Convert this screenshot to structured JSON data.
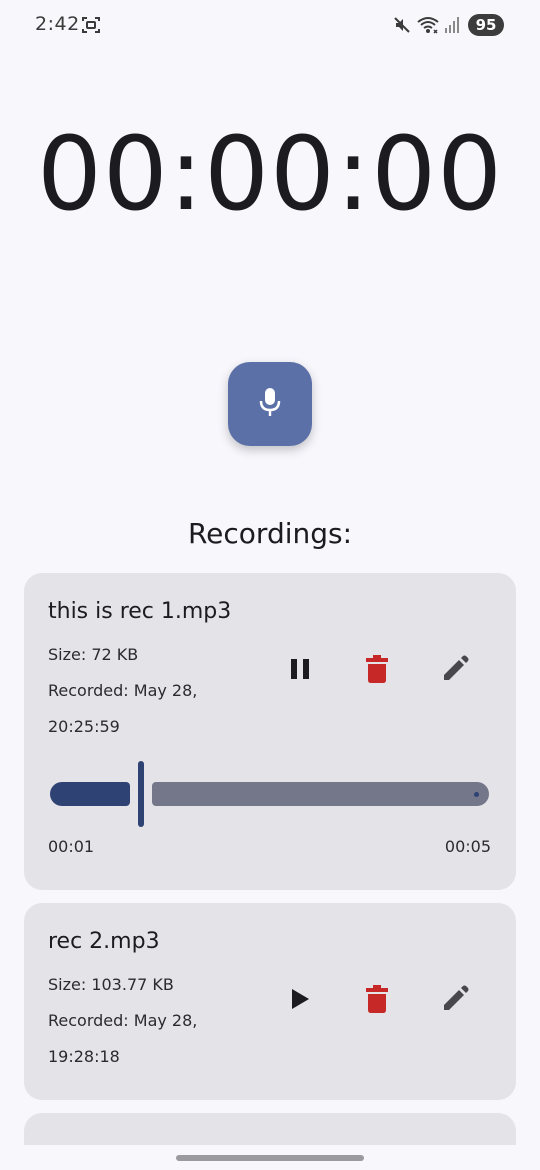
{
  "status_bar": {
    "time": "2:42",
    "battery": "95",
    "icons": [
      "screenshot-icon",
      "mute-icon",
      "wifi-icon",
      "signal-icon"
    ]
  },
  "timer": {
    "display": "00:00:00"
  },
  "record_button": {
    "icon": "microphone-icon",
    "color": "#5c70a8"
  },
  "recordings_heading": "Recordings:",
  "recordings": [
    {
      "title": "this is rec 1.mp3",
      "size": "Size: 72 KB",
      "recorded": "Recorded: May 28, 20:25:59",
      "state": "playing",
      "primary_icon": "pause-icon",
      "position": "00:01",
      "duration": "00:05",
      "progress": 0.2
    },
    {
      "title": "rec 2.mp3",
      "size": "Size: 103.77 KB",
      "recorded": "Recorded: May 28, 19:28:18",
      "state": "stopped",
      "primary_icon": "play-icon"
    },
    {
      "title": "",
      "partially_visible": true
    }
  ],
  "colors": {
    "accent": "#5c70a8",
    "seek_active": "#2e4273",
    "seek_inactive": "#737789",
    "delete": "#c62828",
    "card_bg": "#e3e3e8",
    "background": "#f7f7fc"
  }
}
